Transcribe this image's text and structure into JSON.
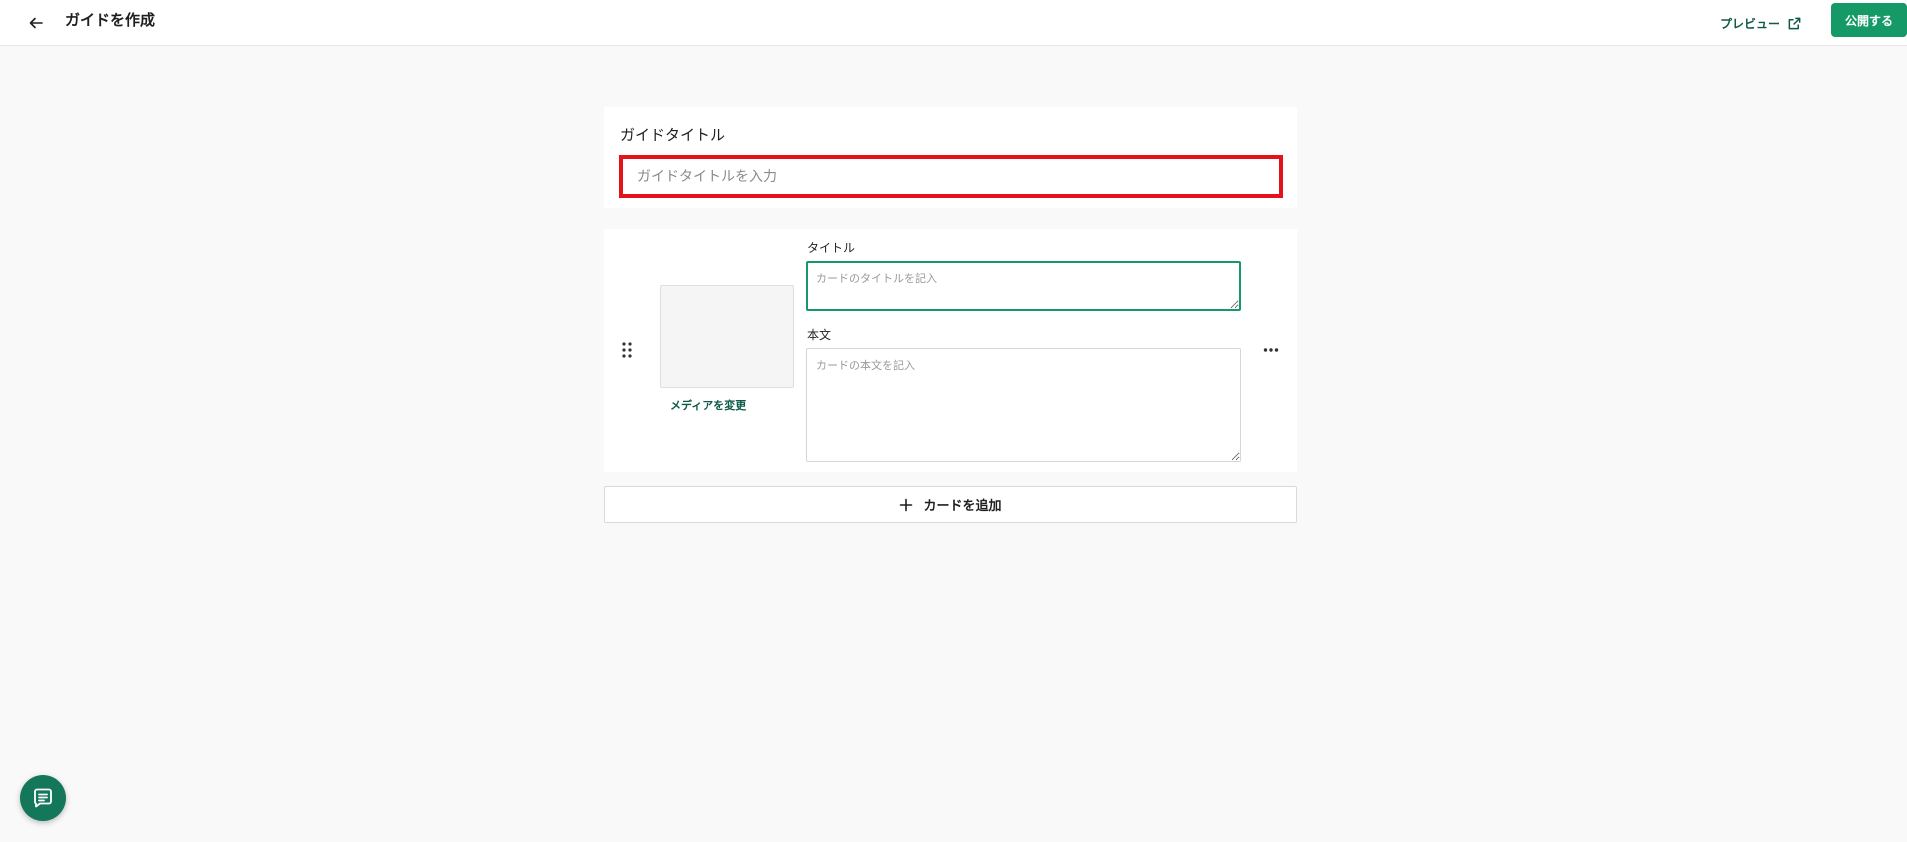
{
  "header": {
    "title": "ガイドを作成",
    "back_icon": "arrow-left-icon",
    "preview_label": "プレビュー",
    "preview_icon": "external-link-icon",
    "publish_label": "公開する"
  },
  "guide_title": {
    "label": "ガイドタイトル",
    "value": "",
    "placeholder": "ガイドタイトルを入力"
  },
  "card": {
    "drag_icon": "drag-handle-icon",
    "media_change_label": "メディアを変更",
    "title_label": "タイトル",
    "title_value": "",
    "title_placeholder": "カードのタイトルを記入",
    "body_label": "本文",
    "body_value": "",
    "body_placeholder": "カードの本文を記入",
    "more_icon": "more-horizontal-icon"
  },
  "add_card": {
    "label": "カードを追加",
    "icon": "plus-icon"
  },
  "chat": {
    "icon": "chat-icon"
  },
  "colors": {
    "accent": "#149967",
    "accent_dark": "#0e5a46",
    "highlight": "#e3121b",
    "background": "#f9f9f9"
  }
}
